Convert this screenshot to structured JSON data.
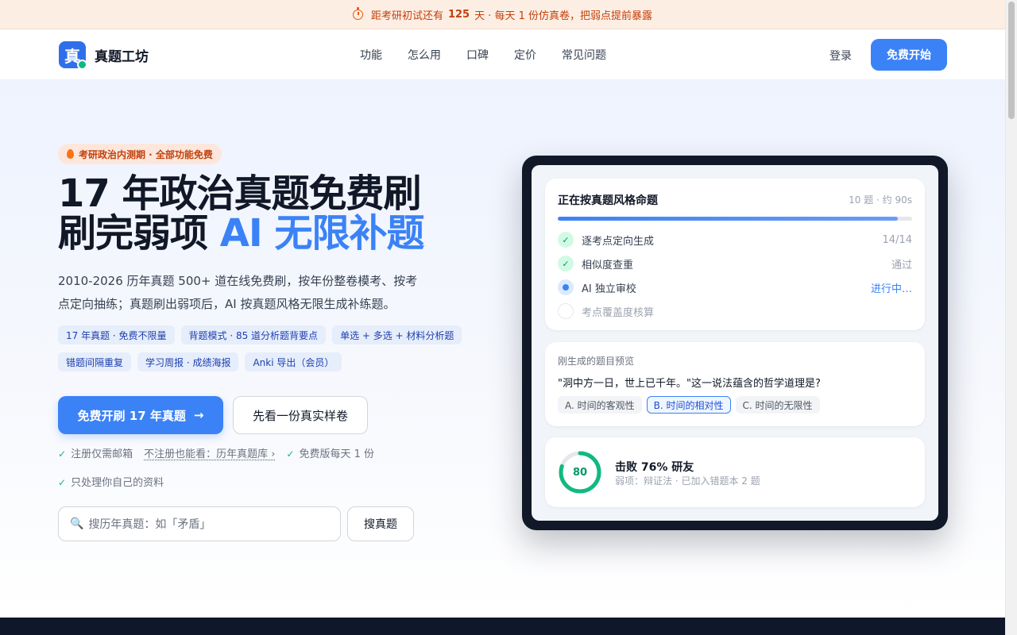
{
  "announcement": {
    "prefix": "距考研初试还有",
    "days": "125",
    "suffix": "天 · 每天 1 份仿真卷，把弱点提前暴露"
  },
  "nav": {
    "brand_logo_char": "真",
    "brand_name": "真题工坊",
    "menu": [
      {
        "label": "功能"
      },
      {
        "label": "怎么用"
      },
      {
        "label": "口碑"
      },
      {
        "label": "定价"
      },
      {
        "label": "常见问题"
      }
    ],
    "login": "登录",
    "start": "免费开始"
  },
  "hero": {
    "badge": "考研政治内测期 · 全部功能免费",
    "title_line1": "17 年政治真题免费刷",
    "title_line2_plain": "刷完弱项 ",
    "title_line2_highlight": "AI 无限补题",
    "desc": "2010-2026 历年真题 500+ 道在线免费刷，按年份整卷模考、按考点定向抽练；真题刷出弱项后，AI 按真题风格无限生成补练题。",
    "tags": [
      "17 年真题 · 免费不限量",
      "背题模式 · 85 道分析题背要点",
      "单选 + 多选 + 材料分析题",
      "错题间隔重复",
      "学习周报 · 成绩海报",
      "Anki 导出（会员）"
    ],
    "cta_primary": "免费开刷 17 年真题",
    "cta_primary_arrow": "→",
    "cta_secondary": "先看一份真实样卷",
    "notes": {
      "email": "注册仅需邮箱",
      "no_register_link": "不注册也能看：历年真题库 ›",
      "daily_free": "免费版每天 1 份",
      "own_data": "只处理你自己的资料",
      "tick": "✓"
    },
    "search": {
      "icon": "🔍",
      "placeholder": "搜历年真题：如「矛盾」",
      "button": "搜真题"
    }
  },
  "mockup": {
    "generating": {
      "title": "正在按真题风格命题",
      "meta": "10 题 · 约 90s",
      "progress": 0.96,
      "steps": [
        {
          "label": "逐考点定向生成",
          "value": "14/14",
          "state": "done"
        },
        {
          "label": "相似度查重",
          "value": "通过",
          "state": "done"
        },
        {
          "label": "AI 独立审校",
          "value": "进行中…",
          "state": "active"
        },
        {
          "label": "考点覆盖度核算",
          "value": "",
          "state": "pending"
        }
      ]
    },
    "preview": {
      "label": "刚生成的题目预览",
      "question": "\"洞中方一日，世上已千年。\"这一说法蕴含的哲学道理是?",
      "options": [
        {
          "text": "A. 时间的客观性",
          "selected": false
        },
        {
          "text": "B. 时间的相对性",
          "selected": true
        },
        {
          "text": "C. 时间的无限性",
          "selected": false
        }
      ]
    },
    "score": {
      "value": "80",
      "percent": 0.8,
      "title": "击败 76% 研友",
      "subtitle": "弱项：辩证法 · 已加入错题本 2 题"
    }
  },
  "colors": {
    "accent": "#3b82f6",
    "success": "#10b981",
    "announce_bg": "#fdeee4",
    "device": "#111827"
  }
}
